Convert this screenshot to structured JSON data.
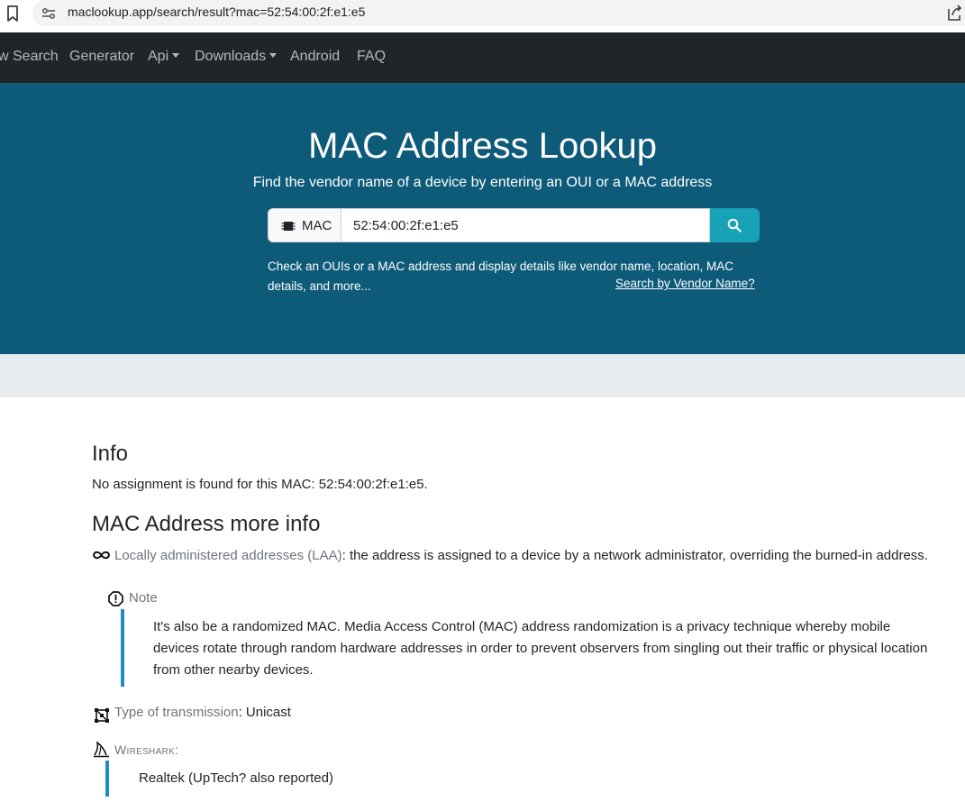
{
  "browser": {
    "url": "maclookup.app/search/result?mac=52:54:00:2f:e1:e5"
  },
  "navbar": {
    "items": [
      {
        "label": "w Search"
      },
      {
        "label": "Generator"
      },
      {
        "label": "Api"
      },
      {
        "label": "Downloads"
      },
      {
        "label": "Android"
      },
      {
        "label": "FAQ"
      }
    ]
  },
  "hero": {
    "title": "MAC Address Lookup",
    "subtitle": "Find the vendor name of a device by entering an OUI or a MAC address",
    "addon_label": "MAC",
    "input_value": "52:54:00:2f:e1:e5",
    "description": "Check an OUIs or a MAC address and display details like vendor name, location, MAC details, and more...",
    "vendor_link": "Search by Vendor Name?"
  },
  "info": {
    "heading": "Info",
    "text": "No assignment is found for this MAC: 52:54:00:2f:e1:e5."
  },
  "more_info": {
    "heading": "MAC Address more info",
    "laa_label": "Locally administered addresses (LAA)",
    "laa_text": ": the address is assigned to a device by a network administrator, overriding the burned-in address.",
    "note_label": "Note",
    "note_text": "It's also be a randomized MAC. Media Access Control (MAC) address randomization is a privacy technique whereby mobile devices rotate through random hardware addresses in order to prevent observers from singling out their traffic or physical location from other nearby devices.",
    "transmission_label": "Type of transmission",
    "transmission_value": ": Unicast",
    "wireshark_label": "Wireshark:",
    "wireshark_text": "Realtek (UpTech? also reported)"
  },
  "colors": {
    "hero_bg": "#0e5b79",
    "navbar_bg": "#212529",
    "accent": "#17a2b8",
    "bar": "#1b8fc2"
  }
}
